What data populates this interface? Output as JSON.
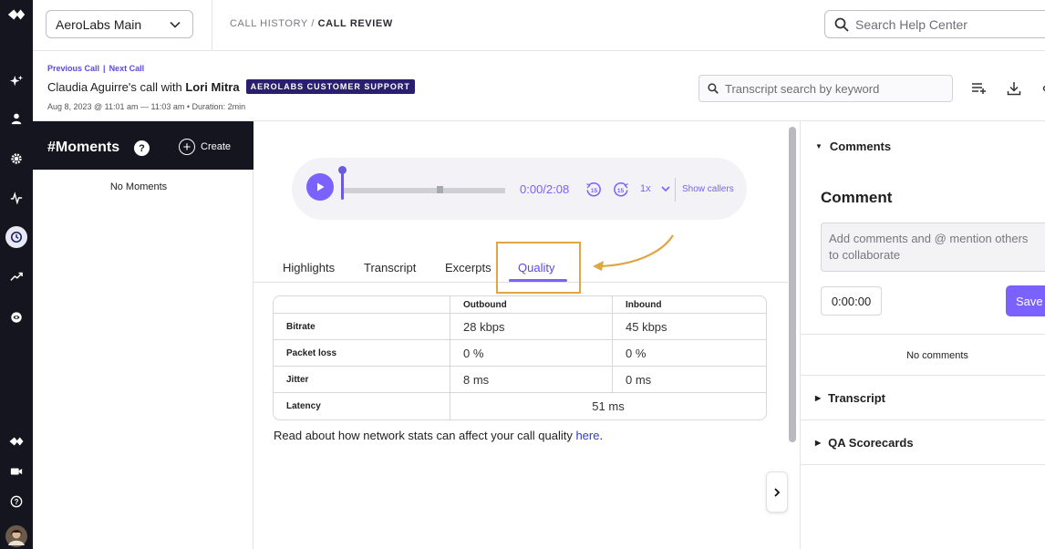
{
  "topbar": {
    "account": "AeroLabs Main",
    "breadcrumb_parent": "CALL HISTORY",
    "breadcrumb_sep": " / ",
    "breadcrumb_current": "CALL REVIEW",
    "help_search_placeholder": "Search Help Center"
  },
  "call": {
    "prev_link": "Previous Call",
    "nav_sep": "|",
    "next_link": "Next Call",
    "agent": "Claudia Aguirre",
    "title_mid": "'s call with ",
    "customer": "Lori Mitra",
    "tag": "AEROLABS CUSTOMER SUPPORT",
    "meta": "Aug 8, 2023 @ 11:01 am — 11:03 am • Duration: 2min",
    "transcript_search_placeholder": "Transcript search by keyword"
  },
  "moments": {
    "title": "#Moments",
    "help": "?",
    "create_label": "Create",
    "empty": "No Moments"
  },
  "player": {
    "time": "0:00/2:08",
    "skip_back": "15",
    "skip_fwd": "15",
    "speed": "1x",
    "show_callers": "Show callers",
    "progress": 0
  },
  "tabs": [
    {
      "label": "Highlights"
    },
    {
      "label": "Transcript"
    },
    {
      "label": "Excerpts"
    },
    {
      "label": "Quality",
      "active": true
    }
  ],
  "quality_table": {
    "headers": [
      "",
      "Outbound",
      "Inbound"
    ],
    "rows": [
      {
        "label": "Bitrate",
        "outbound": "28 kbps",
        "inbound": "45 kbps"
      },
      {
        "label": "Packet loss",
        "outbound": "0 %",
        "inbound": "0 %"
      },
      {
        "label": "Jitter",
        "outbound": "8 ms",
        "inbound": "0 ms"
      },
      {
        "label": "Latency",
        "combined": "51 ms"
      }
    ]
  },
  "read_more": {
    "text": "Read about how network stats can affect your call quality ",
    "link": "here",
    "end": "."
  },
  "right_panel": {
    "comments_section": "Comments",
    "comment_heading": "Comment",
    "comment_placeholder": "Add comments and @ mention others to collaborate",
    "time_value": "0:00:00",
    "save_label": "Save",
    "no_comments": "No comments",
    "transcript_section": "Transcript",
    "qa_section": "QA Scorecards"
  },
  "colors": {
    "accent": "#7b61ff",
    "rail": "#15151f",
    "tag": "#2a1f6e",
    "highlight": "#e0a545"
  }
}
